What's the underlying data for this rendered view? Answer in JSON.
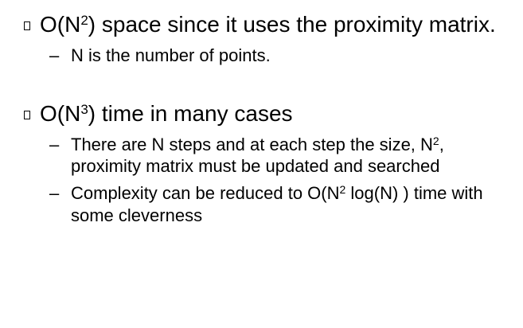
{
  "bullets": [
    {
      "pre": "O(N",
      "sup": "2",
      "post": ") space since it uses the proximity matrix.",
      "subs": [
        {
          "line1": "N is the number of points."
        }
      ]
    },
    {
      "pre": "O(N",
      "sup": "3",
      "post": ") time in many cases",
      "subs": [
        {
          "line1_pre": "There are N steps and at each step the size, N",
          "line1_sup": "2",
          "line1_post": ",",
          "line2": "proximity matrix must be updated and searched"
        },
        {
          "line1_pre": "Complexity can be reduced to O(N",
          "line1_sup": "2",
          "line1_post": " log(N) ) time with",
          "line2": "some cleverness"
        }
      ]
    }
  ],
  "dash_glyph": "–"
}
